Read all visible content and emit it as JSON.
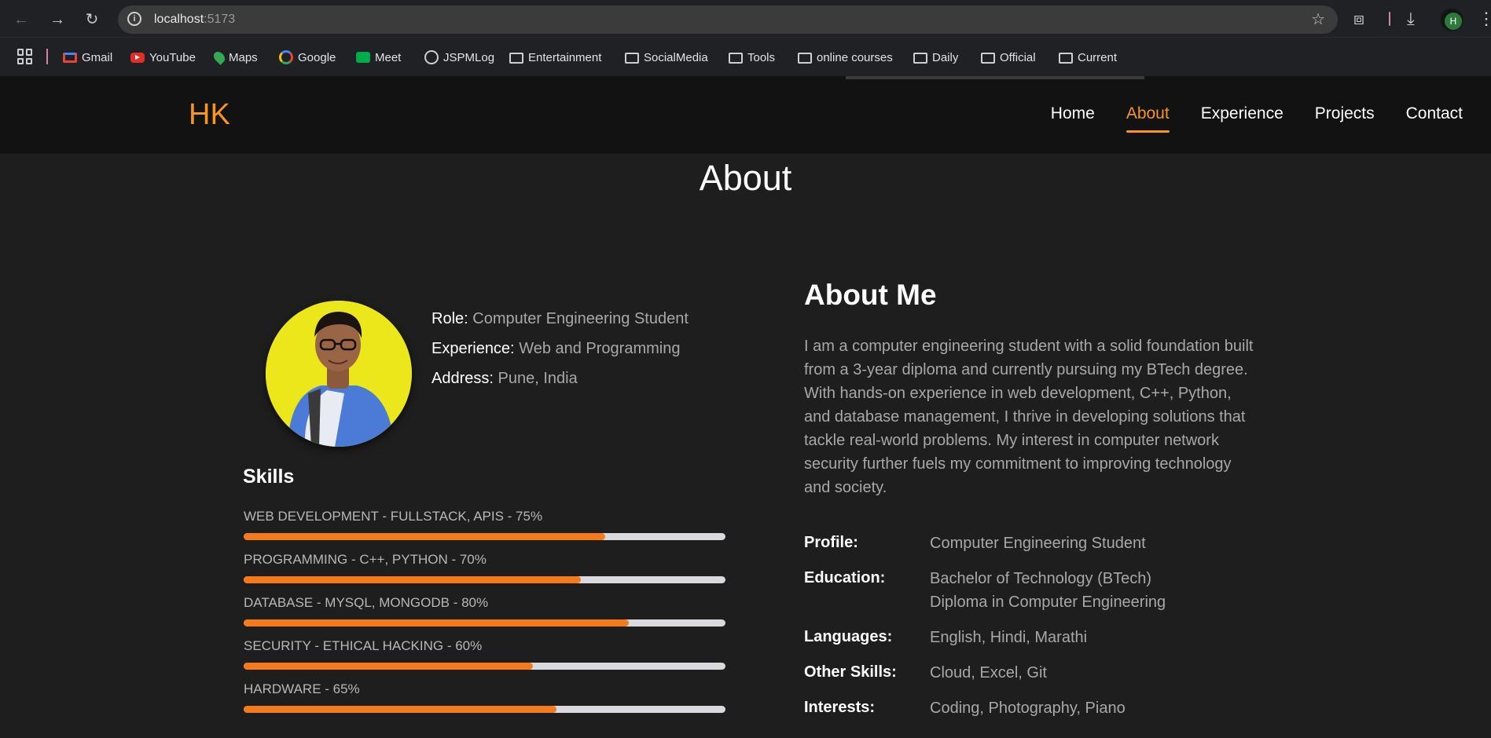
{
  "browser": {
    "url_host": "localhost",
    "url_port": ":5173",
    "profile_initial": "H",
    "bookmarks": [
      {
        "label": "Gmail",
        "icon": "gmail-icon"
      },
      {
        "label": "YouTube",
        "icon": "youtube-icon"
      },
      {
        "label": "Maps",
        "icon": "maps-icon"
      },
      {
        "label": "Google",
        "icon": "google-icon"
      },
      {
        "label": "Meet",
        "icon": "meet-icon"
      },
      {
        "label": "JSPMLog",
        "icon": "globe-icon"
      },
      {
        "label": "Entertainment",
        "icon": "folder-icon"
      },
      {
        "label": "SocialMedia",
        "icon": "folder-icon"
      },
      {
        "label": "Tools",
        "icon": "folder-icon"
      },
      {
        "label": "online courses",
        "icon": "folder-icon"
      },
      {
        "label": "Daily",
        "icon": "folder-icon"
      },
      {
        "label": "Official",
        "icon": "folder-icon"
      },
      {
        "label": "Current",
        "icon": "folder-icon"
      }
    ]
  },
  "site": {
    "logo": "HK",
    "nav": [
      "Home",
      "About",
      "Experience",
      "Projects",
      "Contact"
    ],
    "active_nav": "About",
    "accent_color": "#f79520"
  },
  "about": {
    "page_title": "About",
    "info": [
      {
        "key": "Role:",
        "value": "Computer Engineering Student"
      },
      {
        "key": "Experience:",
        "value": "Web and Programming"
      },
      {
        "key": "Address:",
        "value": "Pune, India"
      }
    ],
    "skills_title": "Skills",
    "skills": [
      {
        "label": "WEB DEVELOPMENT - FULLSTACK, APIS - 75%",
        "percent": 75
      },
      {
        "label": "PROGRAMMING - C++, PYTHON - 70%",
        "percent": 70
      },
      {
        "label": "DATABASE - MYSQL, MONGODB - 80%",
        "percent": 80
      },
      {
        "label": "SECURITY - ETHICAL HACKING - 60%",
        "percent": 60
      },
      {
        "label": "HARDWARE - 65%",
        "percent": 65
      }
    ],
    "about_me_title": "About Me",
    "about_me_text": "I am a computer engineering student with a solid foundation built from a 3-year diploma and currently pursuing my BTech degree. With hands-on experience in web development, C++, Python, and database management, I thrive in developing solutions that tackle real-world problems. My interest in computer network security further fuels my commitment to improving technology and society.",
    "details": [
      {
        "key": "Profile:",
        "lines": [
          "Computer Engineering Student"
        ]
      },
      {
        "key": "Education:",
        "lines": [
          "Bachelor of Technology (BTech)",
          "Diploma in Computer Engineering"
        ]
      },
      {
        "key": "Languages:",
        "lines": [
          "English, Hindi, Marathi"
        ]
      },
      {
        "key": "Other Skills:",
        "lines": [
          "Cloud, Excel, Git"
        ]
      },
      {
        "key": "Interests:",
        "lines": [
          "Coding, Photography, Piano"
        ]
      }
    ]
  }
}
